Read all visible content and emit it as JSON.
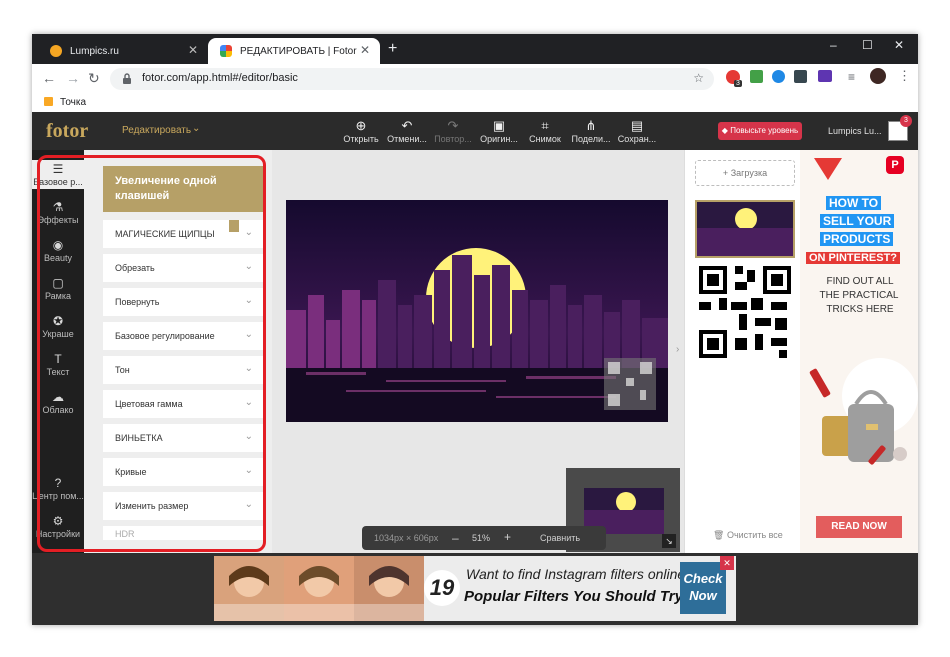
{
  "browser": {
    "tabs": [
      {
        "title": "Lumpics.ru",
        "active": false,
        "favicon_color": "#f5a623"
      },
      {
        "title": "РЕДАКТИРОВАТЬ | Fotor",
        "active": true,
        "favicon_color": "#ea4335"
      }
    ],
    "new_tab_label": "+",
    "controls": {
      "minimize": "–",
      "maximize": "☐",
      "close": "✕"
    },
    "nav": {
      "back": "←",
      "forward": "→",
      "reload": "↻"
    },
    "url": "fotor.com/app.html#/editor/basic",
    "bookmarks": [
      {
        "label": "Точка"
      }
    ],
    "extension_badge": "3"
  },
  "app": {
    "logo": "fotor",
    "mode_label": "Редактировать",
    "toolbar": [
      {
        "label": "Открыть",
        "icon": "image-add-icon",
        "glyph": "⊕",
        "enabled": true
      },
      {
        "label": "Отмени...",
        "icon": "undo-icon",
        "glyph": "↶",
        "enabled": true
      },
      {
        "label": "Повтор...",
        "icon": "redo-icon",
        "glyph": "↷",
        "enabled": false
      },
      {
        "label": "Оригин...",
        "icon": "original-icon",
        "glyph": "▣",
        "enabled": true
      },
      {
        "label": "Снимок",
        "icon": "snapshot-icon",
        "glyph": "⌗",
        "enabled": true
      },
      {
        "label": "Подели...",
        "icon": "share-icon",
        "glyph": "⋔",
        "enabled": true
      },
      {
        "label": "Сохран...",
        "icon": "save-icon",
        "glyph": "▤",
        "enabled": true
      }
    ],
    "upgrade_label": "Повысьте уровень",
    "user_name": "Lumpics Lu...",
    "notification_count": "3",
    "left_nav": [
      {
        "label": "Базовое р...",
        "icon": "sliders-icon",
        "glyph": "☰"
      },
      {
        "label": "Эффекты",
        "icon": "flask-icon",
        "glyph": "⚗"
      },
      {
        "label": "Beauty",
        "icon": "eye-icon",
        "glyph": "◉"
      },
      {
        "label": "Рамка",
        "icon": "frame-icon",
        "glyph": "▢"
      },
      {
        "label": "Украше",
        "icon": "star-icon",
        "glyph": "✪"
      },
      {
        "label": "Текст",
        "icon": "text-icon",
        "glyph": "T"
      },
      {
        "label": "Облако",
        "icon": "cloud-upload-icon",
        "glyph": "☁"
      },
      {
        "label": "Центр пом...",
        "icon": "help-icon",
        "glyph": "?"
      },
      {
        "label": "Настройки",
        "icon": "settings-icon",
        "glyph": "⚙"
      }
    ],
    "panel": {
      "banner": "Увеличение одной клавишей",
      "items": [
        "МАГИЧЕСКИЕ ЩИПЦЫ",
        "Обрезать",
        "Повернуть",
        "Базовое регулирование",
        "Тон",
        "Цветовая гамма",
        "ВИНЬЕТКА",
        "Кривые",
        "Изменить размер",
        "HDR"
      ]
    },
    "zoom": {
      "dimensions": "1034px × 606px",
      "minus": "–",
      "percent": "51%",
      "plus": "+",
      "compare": "Сравнить"
    },
    "right_panel": {
      "upload_label": "Загрузка",
      "clear_label": "Очистить все"
    },
    "ad_right": {
      "lines_blue": [
        "HOW TO",
        "SELL YOUR",
        "PRODUCTS"
      ],
      "line_red": "ON PINTEREST?",
      "body": [
        "FIND OUT ALL",
        "THE PRACTICAL",
        "TRICKS HERE"
      ],
      "cta": "READ NOW"
    },
    "ad_bottom": {
      "number": "19",
      "line1": "Want to find Instagram filters online?",
      "line2": "Popular Filters You Should Try",
      "cta1": "Check",
      "cta2": "Now"
    }
  }
}
